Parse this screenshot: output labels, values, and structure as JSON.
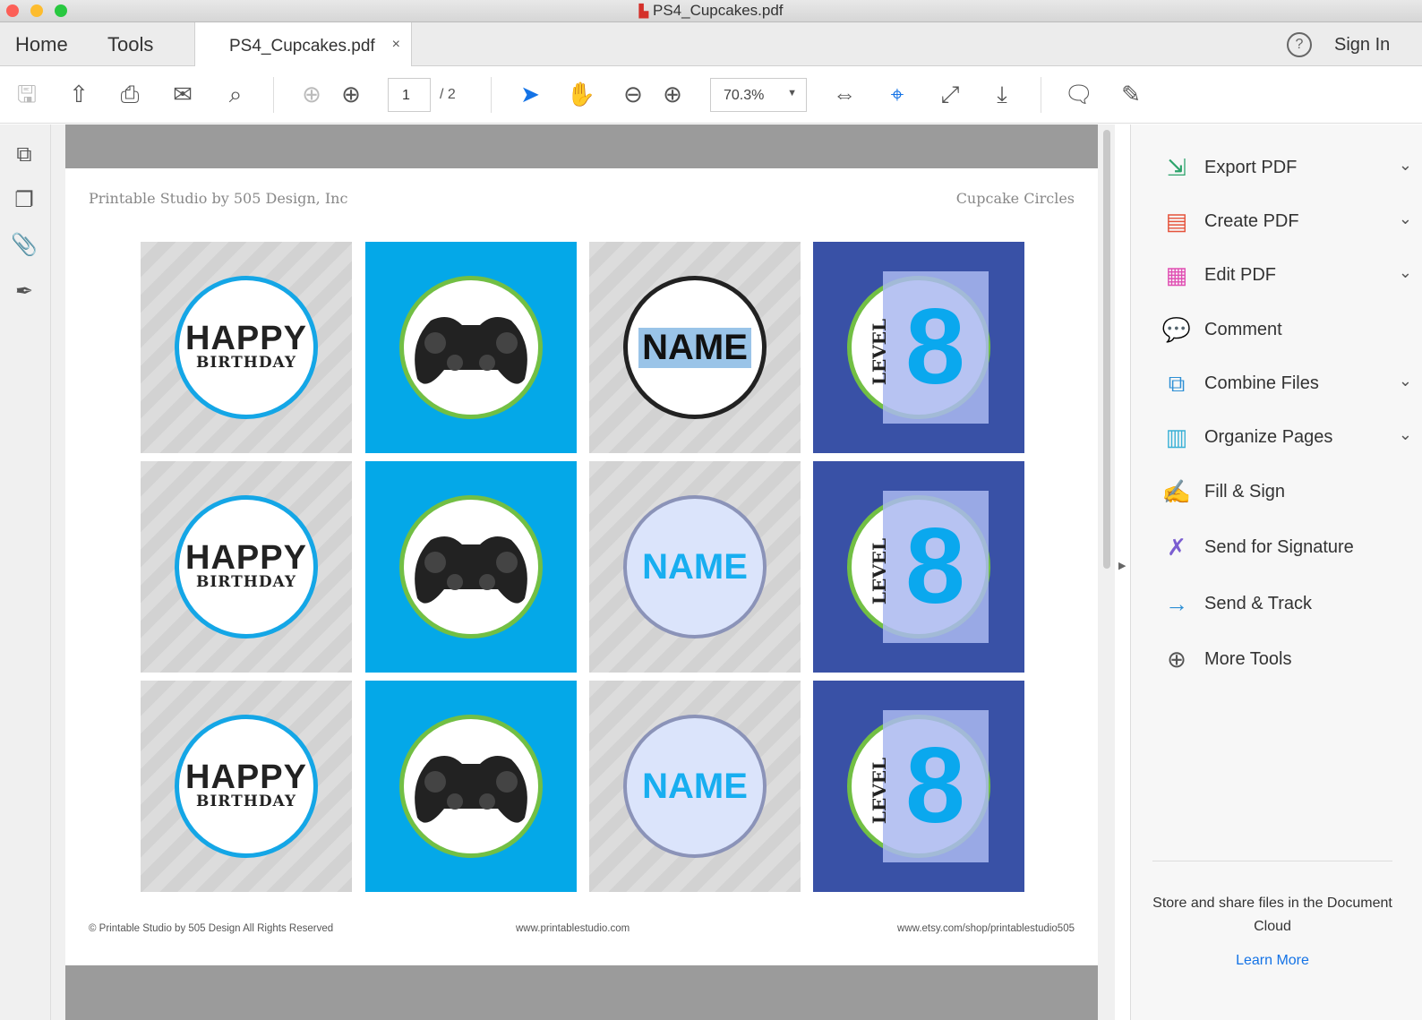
{
  "window": {
    "title": "PS4_Cupcakes.pdf"
  },
  "tabs": {
    "home": "Home",
    "tools": "Tools",
    "document": "PS4_Cupcakes.pdf",
    "close": "×",
    "help": "?",
    "sign_in": "Sign In"
  },
  "toolbar": {
    "page_current": "1",
    "page_total": "/ 2",
    "zoom": "70.3%"
  },
  "page": {
    "header_left": "Printable Studio by 505 Design, Inc",
    "header_right": "Cupcake Circles",
    "footer_left": "© Printable Studio by 505 Design All Rights Reserved",
    "footer_center": "www.printablestudio.com",
    "footer_right": "www.etsy.com/shop/printablestudio505",
    "labels": {
      "happy": "HAPPY",
      "birthday": "BIRTHDAY",
      "name": "NAME",
      "level": "LEVEL",
      "eight": "8"
    },
    "rows": 3,
    "columns": [
      "happy-birthday",
      "controller",
      "name",
      "level-8"
    ]
  },
  "right_panel": {
    "items": [
      {
        "label": "Export PDF",
        "icon": "export-pdf-icon",
        "glyph": "⇲",
        "color": "#2ca36b",
        "chevron": true
      },
      {
        "label": "Create PDF",
        "icon": "create-pdf-icon",
        "glyph": "▤",
        "color": "#e5533c",
        "chevron": true
      },
      {
        "label": "Edit PDF",
        "icon": "edit-pdf-icon",
        "glyph": "▦",
        "color": "#e04fb3",
        "chevron": true
      },
      {
        "label": "Comment",
        "icon": "comment-icon",
        "glyph": "💬",
        "color": "#f2b631",
        "chevron": false
      },
      {
        "label": "Combine Files",
        "icon": "combine-files-icon",
        "glyph": "⧉",
        "color": "#2d8fd5",
        "chevron": true
      },
      {
        "label": "Organize Pages",
        "icon": "organize-pages-icon",
        "glyph": "▥",
        "color": "#3bb1d6",
        "chevron": true
      },
      {
        "label": "Fill & Sign",
        "icon": "fill-sign-icon",
        "glyph": "✍",
        "color": "#8a6fd6",
        "chevron": false
      },
      {
        "label": "Send for Signature",
        "icon": "send-signature-icon",
        "glyph": "✗",
        "color": "#7b5ed1",
        "chevron": false
      },
      {
        "label": "Send & Track",
        "icon": "send-track-icon",
        "glyph": "→",
        "color": "#2d8fd5",
        "chevron": false
      },
      {
        "label": "More Tools",
        "icon": "more-tools-icon",
        "glyph": "⊕",
        "color": "#555555",
        "chevron": false
      }
    ],
    "cloud_text": "Store and share files in the Document Cloud",
    "learn_more": "Learn More"
  }
}
